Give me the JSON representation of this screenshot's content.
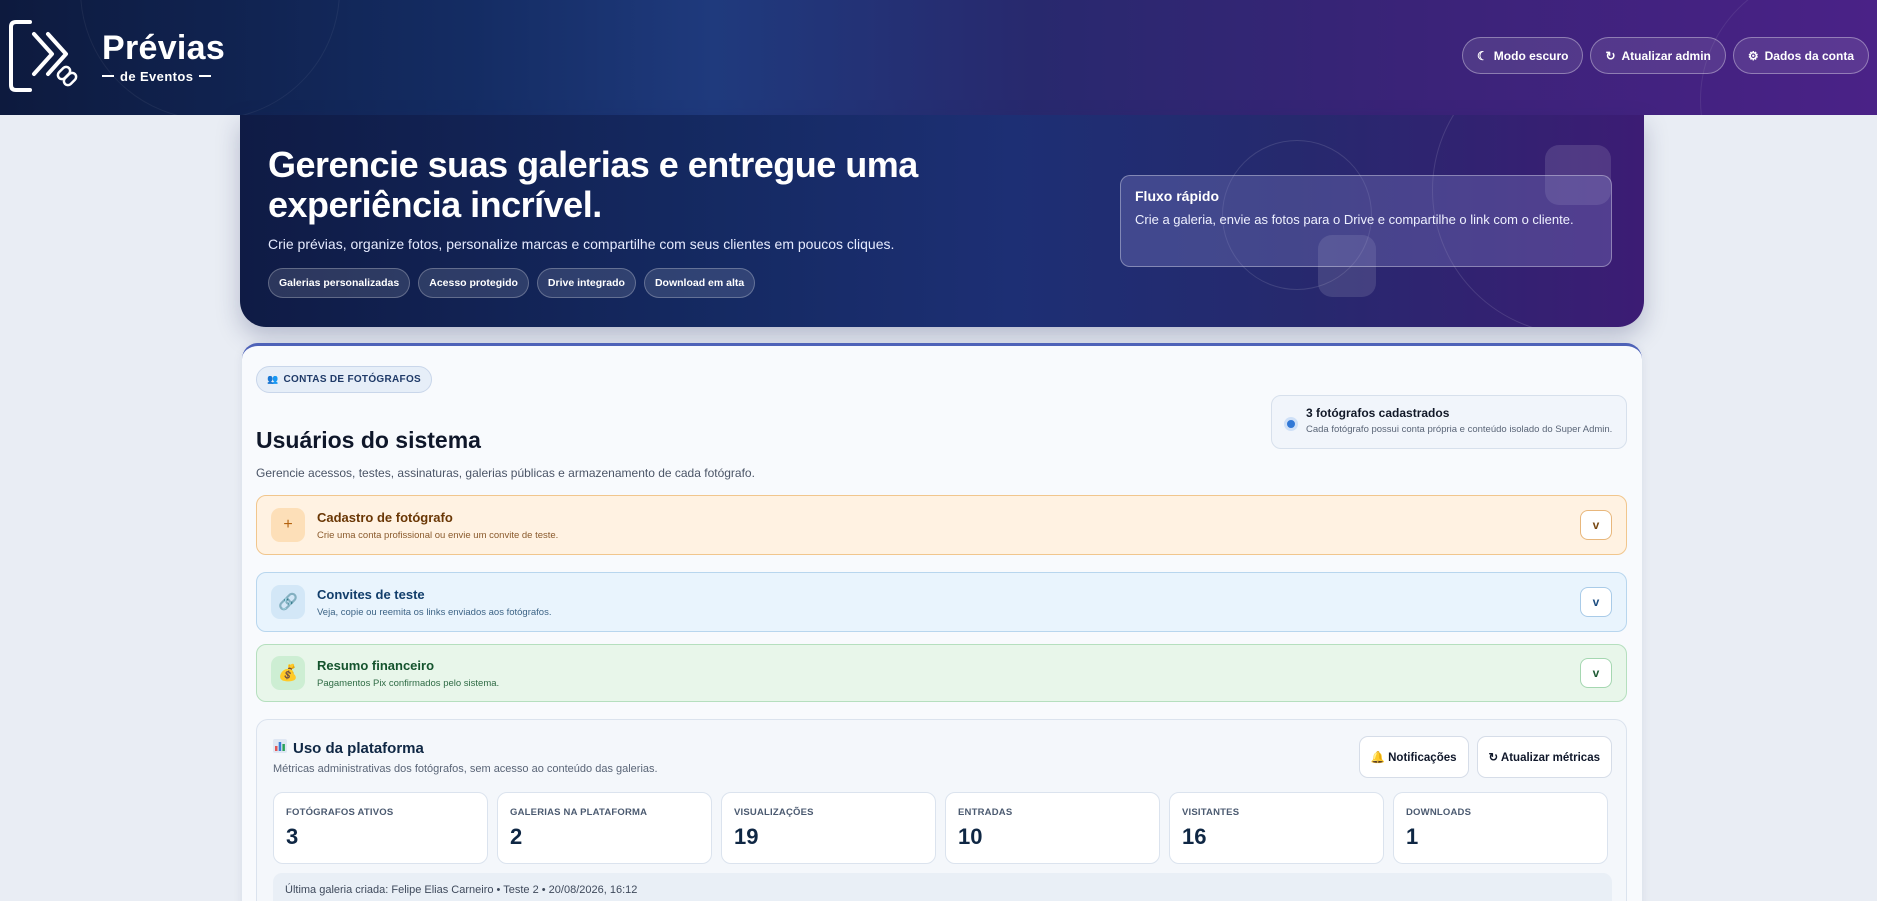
{
  "header": {
    "logo_title": "Prévias",
    "logo_subtitle": "de Eventos",
    "buttons": [
      {
        "icon": "moon-icon",
        "glyph": "☾",
        "label": "Modo escuro"
      },
      {
        "icon": "refresh-icon",
        "glyph": "↻",
        "label": "Atualizar admin"
      },
      {
        "icon": "gear-icon",
        "glyph": "⚙",
        "label": "Dados da conta"
      }
    ]
  },
  "hero": {
    "title": "Gerencie suas galerias e entregue uma experiência incrível.",
    "subtitle": "Crie prévias, organize fotos, personalize marcas e compartilhe com seus clientes em poucos cliques.",
    "chips": [
      "Galerias personalizadas",
      "Acesso protegido",
      "Drive integrado",
      "Download em alta"
    ],
    "quick_flow": {
      "title": "Fluxo rápido",
      "description": "Crie a galeria, envie as fotos para o Drive e compartilhe o link com o cliente."
    }
  },
  "section": {
    "badge": "CONTAS DE FOTÓGRAFOS",
    "title": "Usuários do sistema",
    "description": "Gerencie acessos, testes, assinaturas, galerias públicas e armazenamento de cada fotógrafo.",
    "count_card": {
      "title": "3 fotógrafos cadastrados",
      "description": "Cada fotógrafo possui conta própria e conteúdo isolado do Super Admin."
    }
  },
  "accordions": [
    {
      "icon": "plus-icon",
      "glyph": "+",
      "title": "Cadastro de fotógrafo",
      "description": "Crie uma conta profissional ou envie um convite de teste.",
      "chevron": "v"
    },
    {
      "icon": "link-icon",
      "glyph": "🔗",
      "title": "Convites de teste",
      "description": "Veja, copie ou reemita os links enviados aos fotógrafos.",
      "chevron": "v"
    },
    {
      "icon": "money-bag-icon",
      "glyph": "💰",
      "title": "Resumo financeiro",
      "description": "Pagamentos Pix confirmados pelo sistema.",
      "chevron": "v"
    }
  ],
  "platform": {
    "icon": "chart-icon",
    "title": "Uso da plataforma",
    "description": "Métricas administrativas dos fotógrafos, sem acesso ao conteúdo das galerias.",
    "notifications_label": "🔔 Notificações",
    "refresh_label": "↻ Atualizar métricas",
    "metrics": [
      {
        "label": "FOTÓGRAFOS ATIVOS",
        "value": "3"
      },
      {
        "label": "GALERIAS NA PLATAFORMA",
        "value": "2"
      },
      {
        "label": "VISUALIZAÇÕES",
        "value": "19"
      },
      {
        "label": "ENTRADAS",
        "value": "10"
      },
      {
        "label": "VISITANTES",
        "value": "16"
      },
      {
        "label": "DOWNLOADS",
        "value": "1"
      }
    ],
    "last_gallery": "Última galeria criada: Felipe Elias Carneiro • Teste 2 • 20/08/2026, 16:12"
  }
}
